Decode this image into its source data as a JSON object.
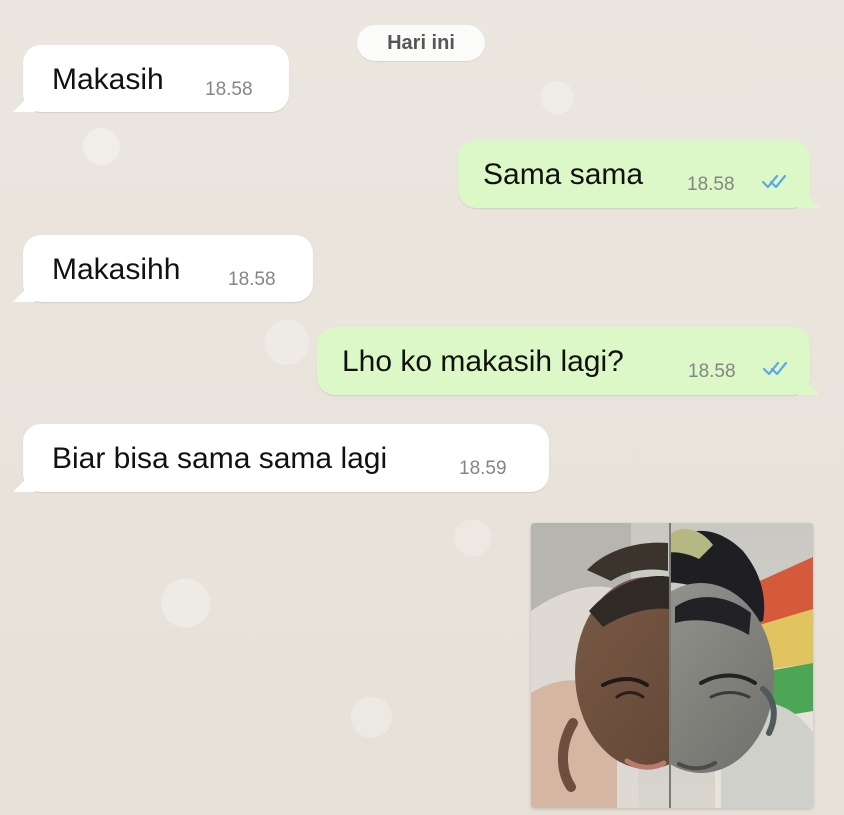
{
  "chat": {
    "date_label": "Hari ini",
    "messages": [
      {
        "text": "Makasih",
        "time": "18.58",
        "direction": "incoming"
      },
      {
        "text": "Sama sama",
        "time": "18.58",
        "direction": "outgoing",
        "status": "read"
      },
      {
        "text": "Makasihh",
        "time": "18.58",
        "direction": "incoming"
      },
      {
        "text": "Lho ko makasih lagi?",
        "time": "18.58",
        "direction": "outgoing",
        "status": "read"
      },
      {
        "text": "Biar bisa sama sama lagi",
        "time": "18.59",
        "direction": "incoming"
      }
    ],
    "image_message": {
      "type": "photo-collage",
      "content": "split-face-image"
    }
  },
  "icons": {
    "read_receipt": "double-check-icon"
  },
  "colors": {
    "background": "#e9e4dd",
    "incoming_bubble": "#ffffff",
    "outgoing_bubble": "#dcf8c6",
    "read_receipt": "#5fa8e8"
  }
}
